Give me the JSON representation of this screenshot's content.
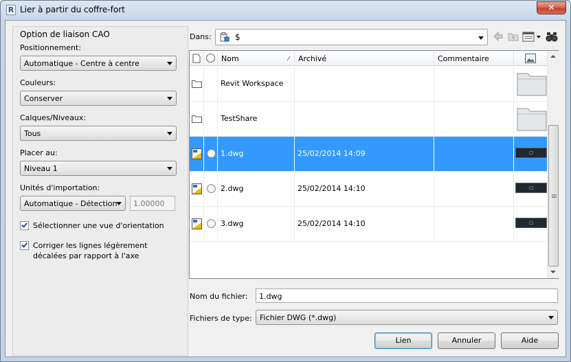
{
  "window": {
    "title": "Lier à partir du coffre-fort",
    "close_symbol": "✕",
    "app_icon_letter": "R"
  },
  "options": {
    "group_title": "Option de liaison CAO",
    "positioning": {
      "label": "Positionnement:",
      "value": "Automatique - Centre à centre"
    },
    "colors": {
      "label": "Couleurs:",
      "value": "Conserver"
    },
    "layers": {
      "label": "Calques/Niveaux:",
      "value": "Tous"
    },
    "place_at": {
      "label": "Placer au:",
      "value": "Niveau 1"
    },
    "units": {
      "label": "Unités d'importation:",
      "value": "Automatique - Détection",
      "scale": "1.00000"
    },
    "orient_view": {
      "label": "Sélectionner une vue d'orientation",
      "checked": true
    },
    "correct_lines": {
      "label_line1": "Corriger les lignes légèrement",
      "label_line2": "décalées par rapport à l'axe",
      "checked": true
    }
  },
  "location": {
    "label": "Dans:",
    "value": "$"
  },
  "file_list": {
    "columns": {
      "name": "Nom",
      "archived": "Archivé",
      "comment": "Commentaire"
    },
    "rows": [
      {
        "type": "folder",
        "name": "Revit Workspace",
        "archived": "",
        "comment": "",
        "selected": false
      },
      {
        "type": "folder",
        "name": "TestShare",
        "archived": "",
        "comment": "",
        "selected": false
      },
      {
        "type": "dwg",
        "name": "1.dwg",
        "archived": "25/02/2014 14:09",
        "comment": "",
        "selected": true
      },
      {
        "type": "dwg",
        "name": "2.dwg",
        "archived": "25/02/2014 14:10",
        "comment": "",
        "selected": false
      },
      {
        "type": "dwg",
        "name": "3.dwg",
        "archived": "25/02/2014 14:10",
        "comment": "",
        "selected": false
      }
    ]
  },
  "file_name": {
    "label": "Nom du fichier:",
    "value": "1.dwg"
  },
  "file_type": {
    "label": "Fichiers de type:",
    "value": "Fichier DWG (*.dwg)"
  },
  "buttons": {
    "link": "Lien",
    "cancel": "Annuler",
    "help": "Aide"
  },
  "colors": {
    "selection": "#3399ff",
    "title_bar": "#c7d7ea",
    "close_button": "#c4412b"
  }
}
